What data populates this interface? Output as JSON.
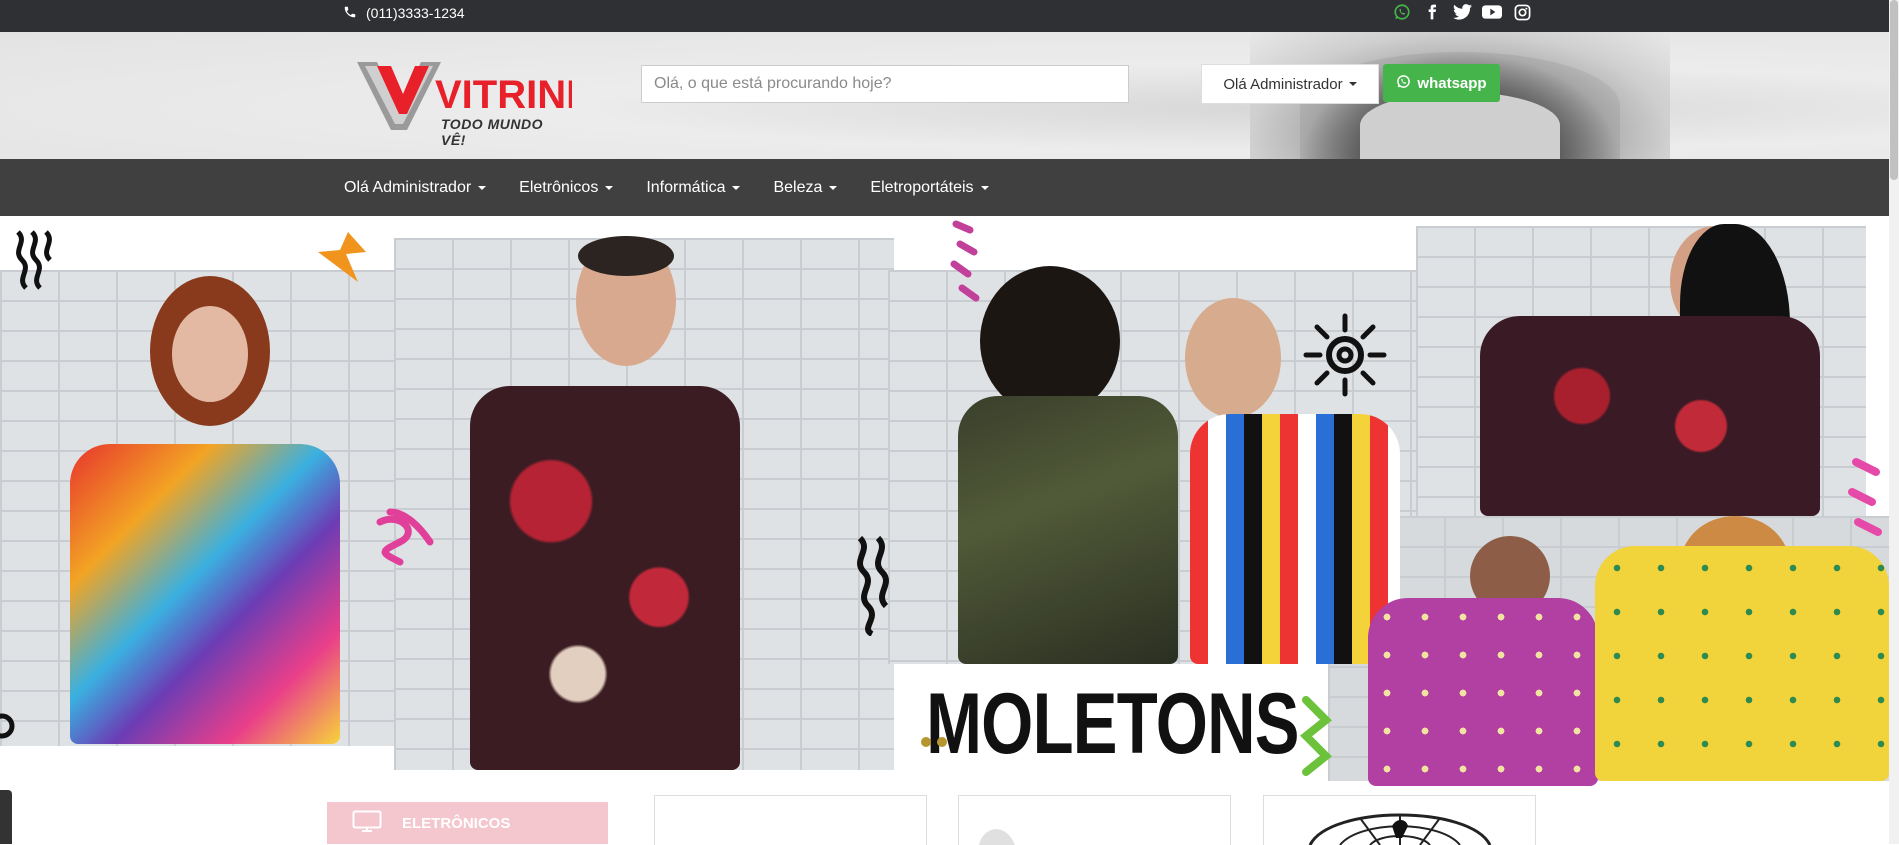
{
  "topbar": {
    "phone": "(011)3333-1234",
    "social_icons": [
      "whatsapp-icon",
      "facebook-icon",
      "twitter-icon",
      "youtube-icon",
      "instagram-icon"
    ]
  },
  "header": {
    "logo_text": "VITRINE",
    "logo_tagline": "TODO MUNDO VÊ!",
    "search_placeholder": "Olá, o que está procurando hoje?",
    "user_button": "Olá Administrador",
    "whatsapp_button": "whatsapp"
  },
  "nav": {
    "items": [
      "Olá Administrador",
      "Eletrônicos",
      "Informática",
      "Beleza",
      "Eletroportáteis"
    ]
  },
  "banner": {
    "headline": "MOLETONS"
  },
  "categories": {
    "first": "ELETRÔNICOS"
  },
  "colors": {
    "topbar": "#2f3033",
    "navbar": "#404040",
    "whatsapp": "#45b44b",
    "logo_red": "#e8202a",
    "category_pink": "#f4c6cd"
  }
}
